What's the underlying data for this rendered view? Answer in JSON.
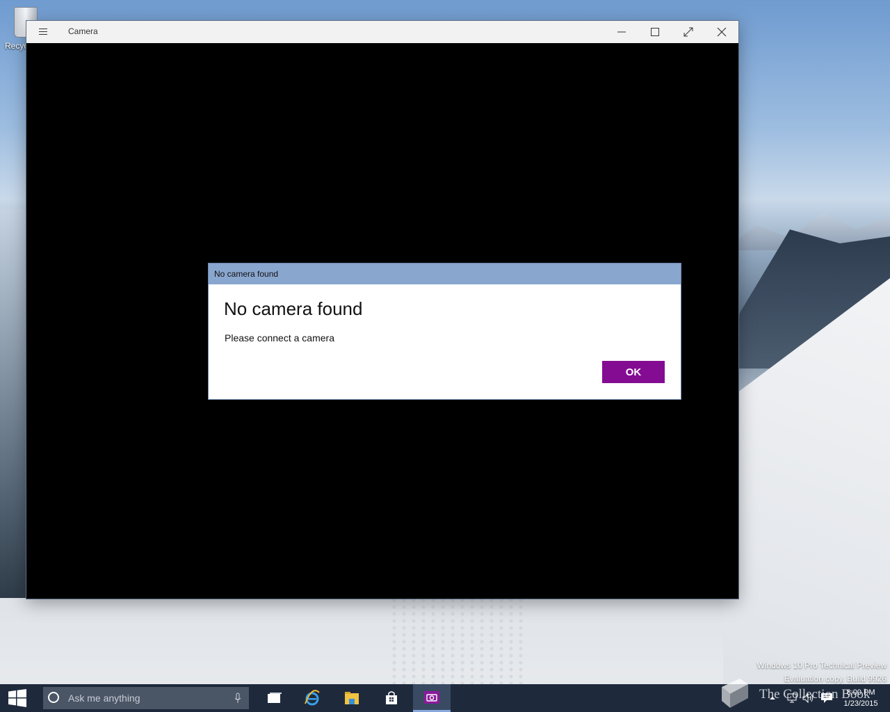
{
  "desktop": {
    "recycle_bin_label": "Recyc",
    "watermark_line1": "Windows 10 Pro Technical Preview",
    "watermark_line2": "Evaluation copy. Build 9926",
    "overlay_watermark": "The Collection Book"
  },
  "window": {
    "title": "Camera",
    "menu_icon": "hamburger-icon",
    "controls": {
      "minimize": "minimize-icon",
      "maximize": "maximize-icon",
      "fullscreen": "fullscreen-icon",
      "close": "close-icon"
    }
  },
  "dialog": {
    "title_bar": "No camera found",
    "heading": "No camera found",
    "message": "Please connect a camera",
    "ok_label": "OK",
    "accent_color": "#840c93",
    "title_bar_color": "#89a6cf"
  },
  "taskbar": {
    "start_icon": "windows-logo-icon",
    "search_placeholder": "Ask me anything",
    "pinned": [
      {
        "name": "task-view",
        "icon": "task-view-icon"
      },
      {
        "name": "internet-explorer",
        "icon": "ie-icon"
      },
      {
        "name": "file-explorer",
        "icon": "folder-icon"
      },
      {
        "name": "store",
        "icon": "store-icon"
      },
      {
        "name": "camera",
        "icon": "camera-icon",
        "active": true
      }
    ],
    "tray_icons": [
      "chevron-up-icon",
      "network-icon",
      "volume-icon",
      "notifications-icon"
    ],
    "time": "8:00 PM",
    "date": "1/23/2015"
  }
}
